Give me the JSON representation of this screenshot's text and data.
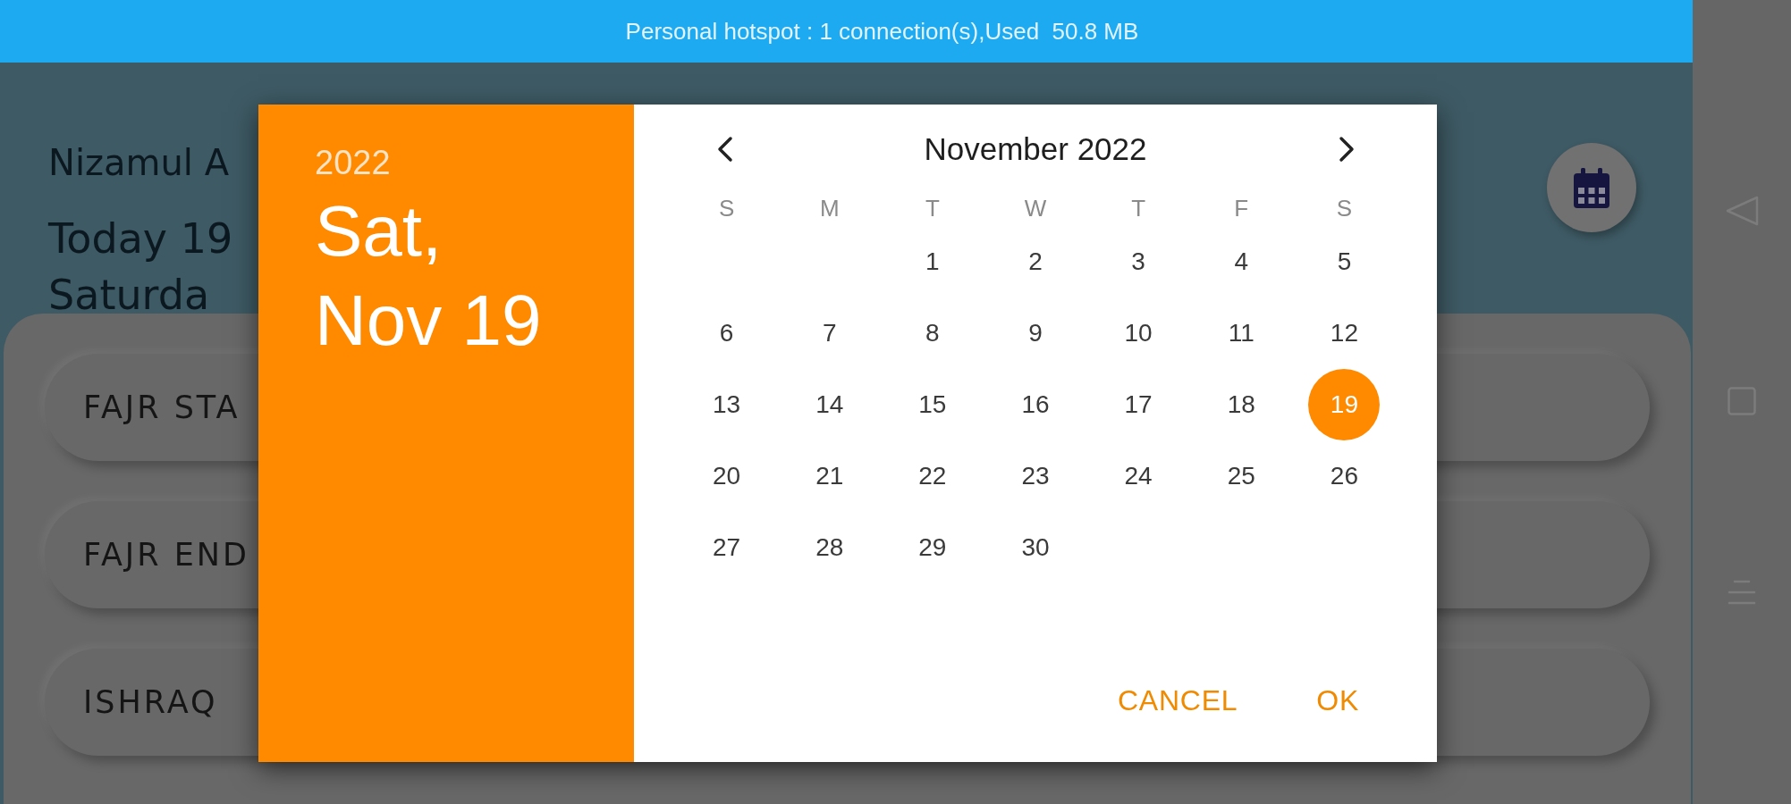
{
  "status_bar": {
    "text": "Personal hotspot : 1 connection(s),Used  50.8 MB"
  },
  "app": {
    "title": "Nizamul A",
    "date": "Today 19",
    "day": "Saturda",
    "prayers": [
      {
        "label": "FAJR STA"
      },
      {
        "label": "FAJR END"
      },
      {
        "label": "ISHRAQ"
      }
    ]
  },
  "date_picker": {
    "year": "2022",
    "selected_date": "Sat, Nov 19",
    "month": "November 2022",
    "weekdays": [
      "S",
      "M",
      "T",
      "W",
      "T",
      "F",
      "S"
    ],
    "weeks": [
      [
        {
          "kind": "empty"
        },
        {
          "kind": "empty"
        },
        {
          "kind": "day",
          "day": "1",
          "selected": false
        },
        {
          "kind": "day",
          "day": "2",
          "selected": false
        },
        {
          "kind": "day",
          "day": "3",
          "selected": false
        },
        {
          "kind": "day",
          "day": "4",
          "selected": false
        },
        {
          "kind": "day",
          "day": "5",
          "selected": false
        }
      ],
      [
        {
          "kind": "day",
          "day": "6",
          "selected": false
        },
        {
          "kind": "day",
          "day": "7",
          "selected": false
        },
        {
          "kind": "day",
          "day": "8",
          "selected": false
        },
        {
          "kind": "day",
          "day": "9",
          "selected": false
        },
        {
          "kind": "day",
          "day": "10",
          "selected": false
        },
        {
          "kind": "day",
          "day": "11",
          "selected": false
        },
        {
          "kind": "day",
          "day": "12",
          "selected": false
        }
      ],
      [
        {
          "kind": "day",
          "day": "13",
          "selected": false
        },
        {
          "kind": "day",
          "day": "14",
          "selected": false
        },
        {
          "kind": "day",
          "day": "15",
          "selected": false
        },
        {
          "kind": "day",
          "day": "16",
          "selected": false
        },
        {
          "kind": "day",
          "day": "17",
          "selected": false
        },
        {
          "kind": "day",
          "day": "18",
          "selected": false
        },
        {
          "kind": "day",
          "day": "19",
          "selected": true
        }
      ],
      [
        {
          "kind": "day",
          "day": "20",
          "selected": false
        },
        {
          "kind": "day",
          "day": "21",
          "selected": false
        },
        {
          "kind": "day",
          "day": "22",
          "selected": false
        },
        {
          "kind": "day",
          "day": "23",
          "selected": false
        },
        {
          "kind": "day",
          "day": "24",
          "selected": false
        },
        {
          "kind": "day",
          "day": "25",
          "selected": false
        },
        {
          "kind": "day",
          "day": "26",
          "selected": false
        }
      ],
      [
        {
          "kind": "day",
          "day": "27",
          "selected": false
        },
        {
          "kind": "day",
          "day": "28",
          "selected": false
        },
        {
          "kind": "day",
          "day": "29",
          "selected": false
        },
        {
          "kind": "day",
          "day": "30",
          "selected": false
        }
      ]
    ],
    "buttons": [
      {
        "label": "CANCEL"
      },
      {
        "label": "OK"
      }
    ]
  }
}
